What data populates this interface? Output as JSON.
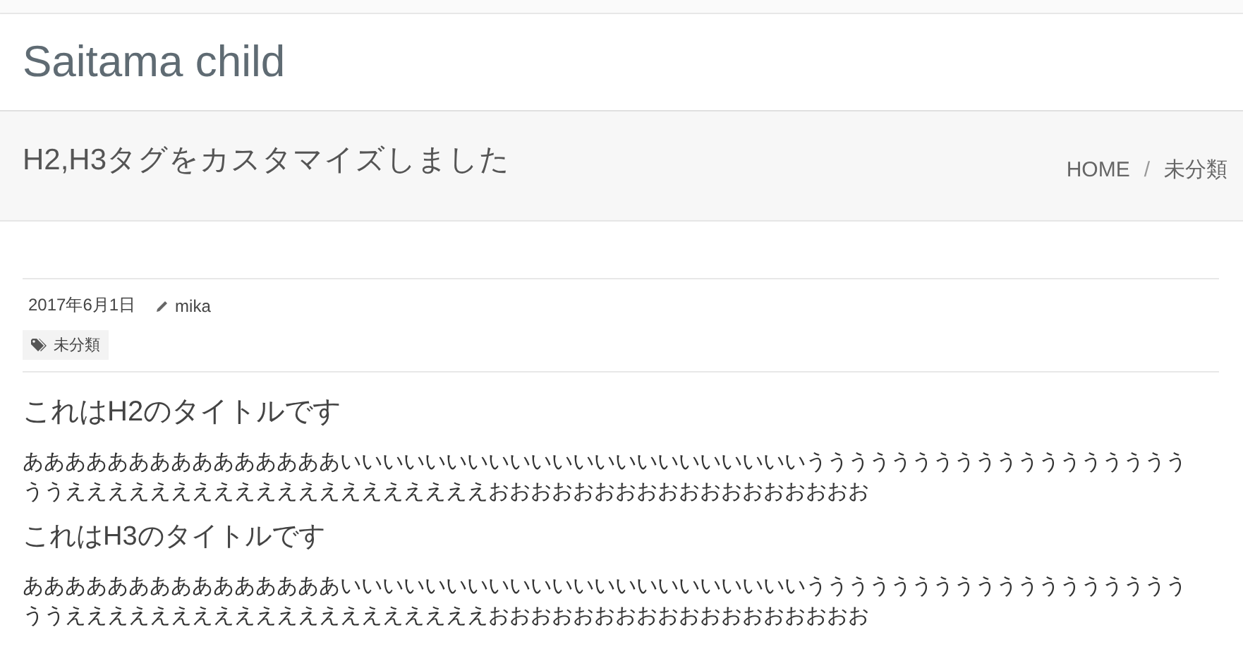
{
  "site": {
    "title": "Saitama child"
  },
  "page_header": {
    "title": "H2,H3タグをカスタマイズしました",
    "breadcrumbs": [
      {
        "label": "HOME"
      },
      {
        "label": "未分類"
      }
    ],
    "separator": "/"
  },
  "post": {
    "date": "2017年6月1日",
    "author": "mika",
    "category": "未分類",
    "sections": [
      {
        "kind": "h2",
        "text": "これはH2のタイトルです"
      },
      {
        "kind": "p",
        "text": "あああああああああああああああいいいいいいいいいいいいいいいいいいいいいいううううううううううううううううううううええええええええええええええええええええおおおおおおおおおおおおおおおおおお"
      },
      {
        "kind": "h3",
        "text": "これはH3のタイトルです"
      },
      {
        "kind": "p",
        "text": "あああああああああああああああいいいいいいいいいいいいいいいいいいいいいいううううううううううううううううううううええええええええええええええええええええおおおおおおおおおおおおおおおおおお"
      }
    ]
  }
}
